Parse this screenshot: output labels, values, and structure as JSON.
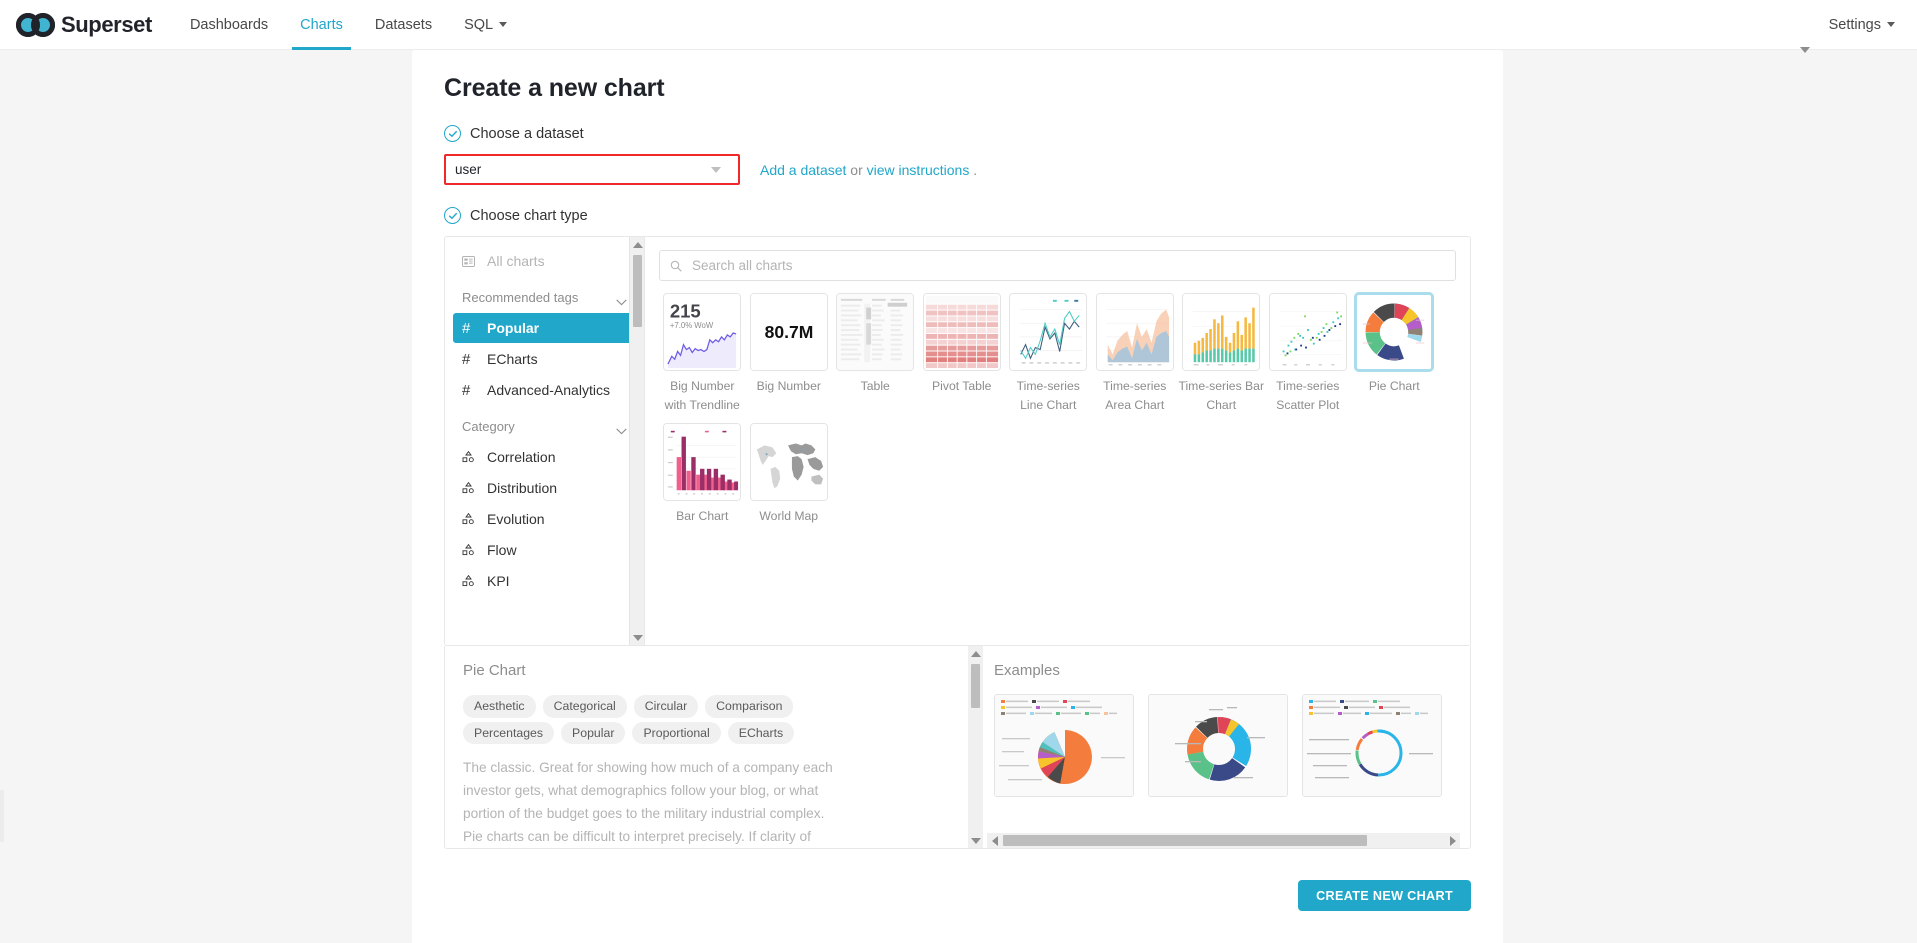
{
  "navbar": {
    "brand": "Superset",
    "brand_logo_icon": "superset-infinity-logo",
    "links": [
      {
        "label": "Dashboards",
        "active": false,
        "has_caret": false
      },
      {
        "label": "Charts",
        "active": true,
        "has_caret": false
      },
      {
        "label": "Datasets",
        "active": false,
        "has_caret": false
      },
      {
        "label": "SQL",
        "active": false,
        "has_caret": true
      }
    ],
    "settings_label": "Settings",
    "settings_caret_icon": "caret-down-icon",
    "accent_color": "#20a7c9"
  },
  "page": {
    "title": "Create a new chart"
  },
  "steps": {
    "dataset": {
      "label": "Choose a dataset",
      "check_icon": "check-circle-icon"
    },
    "chart_type": {
      "label": "Choose chart type",
      "check_icon": "check-circle-icon"
    }
  },
  "dataset": {
    "selected_value": "user",
    "placeholder": "Choose a dataset",
    "caret_icon": "chevron-down-icon",
    "highlight_color": "#ef2929",
    "add_link": "Add a dataset",
    "or_text": " or ",
    "instructions_link": "view instructions",
    "trailing_text": " ."
  },
  "sidebar": {
    "all_charts": {
      "label": "All charts",
      "icon": "all-charts-icon"
    },
    "groups": [
      {
        "label": "Recommended tags",
        "caret_icon": "chevron-down-icon",
        "items": [
          {
            "label": "Popular",
            "icon": "hash-icon",
            "active": true
          },
          {
            "label": "ECharts",
            "icon": "hash-icon",
            "active": false
          },
          {
            "label": "Advanced-Analytics",
            "icon": "hash-icon",
            "active": false
          }
        ]
      },
      {
        "label": "Category",
        "caret_icon": "chevron-down-icon",
        "items": [
          {
            "label": "Correlation",
            "icon": "category-icon",
            "active": false
          },
          {
            "label": "Distribution",
            "icon": "category-icon",
            "active": false
          },
          {
            "label": "Evolution",
            "icon": "category-icon",
            "active": false
          },
          {
            "label": "Flow",
            "icon": "category-icon",
            "active": false
          },
          {
            "label": "KPI",
            "icon": "category-icon",
            "active": false
          }
        ]
      }
    ],
    "scrollbar": {
      "up_icon": "triangle-up-icon",
      "down_icon": "triangle-down-icon"
    }
  },
  "search": {
    "placeholder": "Search all charts",
    "value": "",
    "icon": "search-icon"
  },
  "chart_types": [
    {
      "label": "Big Number with Trendline",
      "thumb": "big-number-trendline",
      "selected": false
    },
    {
      "label": "Big Number",
      "thumb": "big-number",
      "selected": false
    },
    {
      "label": "Table",
      "thumb": "table",
      "selected": false
    },
    {
      "label": "Pivot Table",
      "thumb": "pivot-table",
      "selected": false
    },
    {
      "label": "Time-series Line Chart",
      "thumb": "line",
      "selected": false
    },
    {
      "label": "Time-series Area Chart",
      "thumb": "area",
      "selected": false
    },
    {
      "label": "Time-series Bar Chart",
      "thumb": "bar",
      "selected": false
    },
    {
      "label": "Time-series Scatter Plot",
      "thumb": "scatter",
      "selected": false
    },
    {
      "label": "Pie Chart",
      "thumb": "pie",
      "selected": true
    },
    {
      "label": "Bar Chart",
      "thumb": "barchart",
      "selected": false
    },
    {
      "label": "World Map",
      "thumb": "worldmap",
      "selected": false
    }
  ],
  "thumbnails": {
    "big_number_trendline": {
      "value": "215",
      "delta": "+7.0% WoW"
    },
    "big_number": {
      "value": "80.7M"
    }
  },
  "details": {
    "title": "Pie Chart",
    "tags": [
      "Aesthetic",
      "Categorical",
      "Circular",
      "Comparison",
      "Percentages",
      "Popular",
      "Proportional",
      "ECharts"
    ],
    "description": "The classic. Great for showing how much of a company each investor gets, what demographics follow your blog, or what portion of the budget goes to the military industrial complex. Pie charts can be difficult to interpret precisely. If clarity of relative"
  },
  "examples": {
    "title": "Examples",
    "items": [
      {
        "name": "pie-example-full",
        "type": "pie"
      },
      {
        "name": "pie-example-donut",
        "type": "donut"
      },
      {
        "name": "pie-example-thin-ring",
        "type": "thin-ring"
      }
    ],
    "hscroll": {
      "left_icon": "triangle-left-icon",
      "right_icon": "triangle-right-icon"
    }
  },
  "footer": {
    "create_button": "CREATE NEW CHART",
    "button_color": "#20a7c9"
  }
}
